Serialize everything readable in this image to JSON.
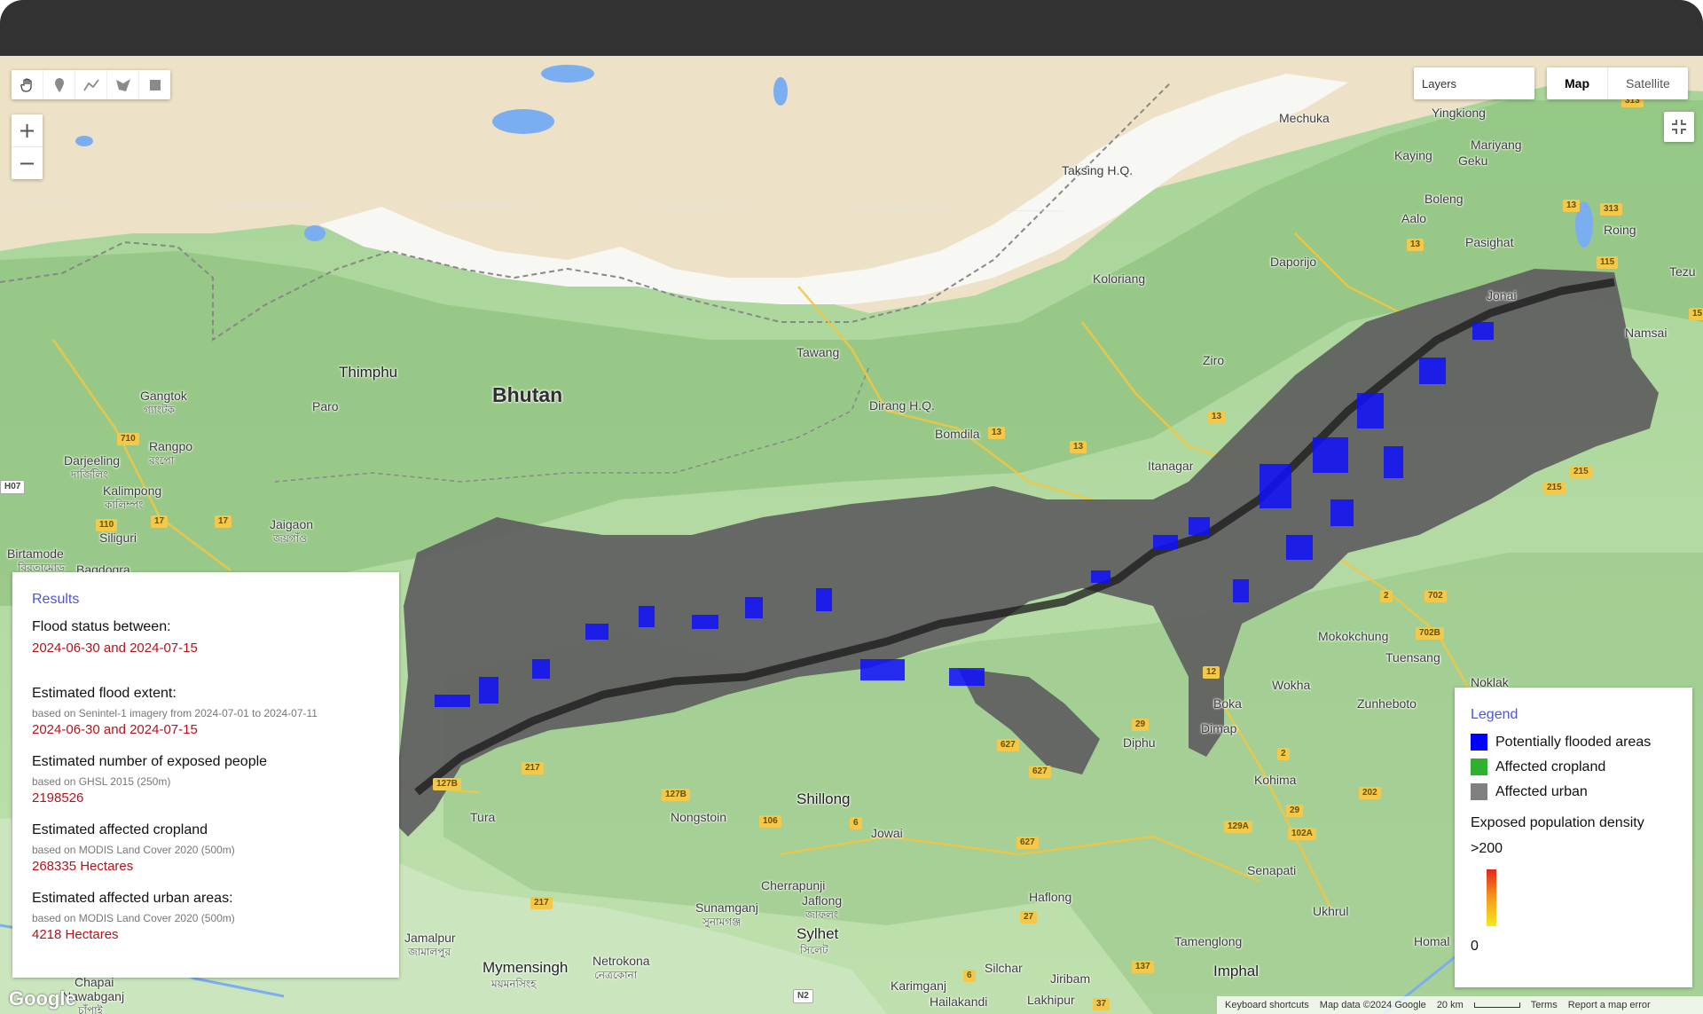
{
  "toolbar": {
    "tools": [
      "hand-icon",
      "pin-icon",
      "polyline-icon",
      "polygon-icon",
      "rectangle-icon"
    ]
  },
  "zoom": {
    "in_label": "+",
    "out_label": "−"
  },
  "layers": {
    "label": "Layers"
  },
  "maptype": {
    "map": "Map",
    "satellite": "Satellite"
  },
  "map_labels": {
    "bhutan": "Bhutan",
    "thimphu": "Thimphu",
    "paro": "Paro",
    "gangtok": "Gangtok",
    "gangtok_local": "গ্যাংটক",
    "darjeeling": "Darjeeling",
    "darjeeling_local": "দার্জিলিং",
    "rangpo": "Rangpo",
    "rangpo_local": "রংপো",
    "kalimpong": "Kalimpong",
    "kalimpong_local": "কালিম্পং",
    "siliguri": "Siliguri",
    "jaigaon": "Jaigaon",
    "jaigaon_local": "জয়গাঁও",
    "birtamode": "Birtamode",
    "birtamode_local": "বিরতামোড",
    "bagdogra": "Bagdogra",
    "tawang": "Tawang",
    "dirang": "Dirang H.Q.",
    "bomdila": "Bomdila",
    "itanagar": "Itanagar",
    "ziro": "Ziro",
    "koloriang": "Koloriang",
    "daporijo": "Daporijo",
    "taksing": "Taksing H.Q.",
    "mechuka": "Mechuka",
    "yingkiong": "Yingkiong",
    "mariyang": "Mariyang",
    "kaying": "Kaying",
    "geku": "Geku",
    "boleng": "Boleng",
    "aalo": "Aalo",
    "pasighat": "Pasighat",
    "roing": "Roing",
    "tezu": "Tezu",
    "jonai": "Jonai",
    "namsai": "Namsai",
    "mokokchung": "Mokokchung",
    "tuensang": "Tuensang",
    "wokha": "Wokha",
    "zunheboto": "Zunheboto",
    "noklak": "Noklak",
    "kohima": "Kohima",
    "dimapur": "Dimap",
    "diphu": "Diphu",
    "boka": "Boka",
    "shillong": "Shillong",
    "tura": "Tura",
    "nongstoin": "Nongstoin",
    "jowai": "Jowai",
    "cherrapunji": "Cherrapunji",
    "sunamganj": "Sunamganj",
    "sunamganj_local": "সুনামগঞ্জ",
    "jaflong": "Jaflong",
    "jaflong_local": "জাফলং",
    "sylhet": "Sylhet",
    "sylhet_local": "সিলেট",
    "haflong": "Haflong",
    "senapati": "Senapati",
    "ukhrul": "Ukhrul",
    "tamenglong": "Tamenglong",
    "silchar": "Silchar",
    "jiribam": "Jiribam",
    "imphal": "Imphal",
    "karimganj": "Karimganj",
    "hailakandi": "Hailakandi",
    "lakhipur": "Lakhipur",
    "jamalpur": "Jamalpur",
    "jamalpur_local": "জামালপুর",
    "mymensingh": "Mymensingh",
    "mymensingh_local": "ময়মনসিংহ",
    "netrokona": "Netrokona",
    "netrokona_local": "নেত্রকোনা",
    "chapai": "Chapai",
    "nawabganj": "Nawabganj",
    "nawabganj_local": "চাঁপাই",
    "homal": "Homal"
  },
  "road_labels": [
    "710",
    "110",
    "17",
    "17",
    "13",
    "13",
    "13",
    "13",
    "13",
    "313",
    "313",
    "115",
    "15",
    "215",
    "215",
    "2",
    "702",
    "702B",
    "12",
    "202",
    "29",
    "29",
    "627",
    "627",
    "627",
    "6",
    "106",
    "217",
    "217",
    "127B",
    "127B",
    "129A",
    "102A",
    "202",
    "37",
    "137",
    "27",
    "2",
    "6",
    "H07",
    "N2"
  ],
  "results": {
    "title": "Results",
    "flood_status_heading": "Flood status between:",
    "flood_status_value": "2024-06-30 and 2024-07-15",
    "extent_heading": "Estimated flood extent:",
    "extent_note": "based on Senintel-1 imagery from 2024-07-01 to 2024-07-11",
    "extent_value": "2024-06-30 and 2024-07-15",
    "people_heading": "Estimated number of exposed people",
    "people_note": "based on GHSL 2015 (250m)",
    "people_value": "2198526",
    "cropland_heading": "Estimated affected cropland",
    "cropland_note": "based on MODIS Land Cover 2020 (500m)",
    "cropland_value": "268335 Hectares",
    "urban_heading": "Estimated affected urban areas:",
    "urban_note": "based on MODIS Land Cover 2020 (500m)",
    "urban_value": "4218 Hectares"
  },
  "legend": {
    "title": "Legend",
    "items": [
      {
        "label": "Potentially flooded areas",
        "color": "#0000ff"
      },
      {
        "label": "Affected cropland",
        "color": "#2eb12e"
      },
      {
        "label": "Affected urban",
        "color": "#808080"
      }
    ],
    "density_heading": "Exposed population density",
    "density_max": ">200",
    "density_min": "0"
  },
  "attribution": {
    "shortcuts": "Keyboard shortcuts",
    "mapdata": "Map data ©2024 Google",
    "scale": "20 km",
    "terms": "Terms",
    "report": "Report a map error"
  },
  "google_logo": "Google"
}
